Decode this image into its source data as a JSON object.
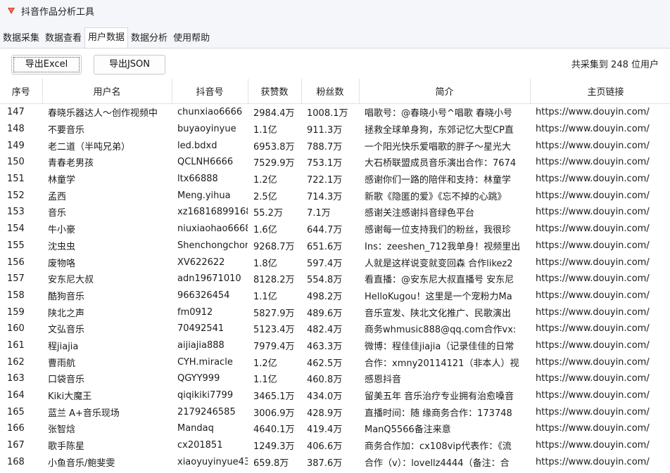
{
  "window": {
    "title": "抖音作品分析工具",
    "icon": "app-logo-icon",
    "accent_color": "#d9383a"
  },
  "tabs": [
    {
      "label": "数据采集",
      "active": false
    },
    {
      "label": "数据查看",
      "active": false
    },
    {
      "label": "用户数据",
      "active": true
    },
    {
      "label": "数据分析",
      "active": false
    },
    {
      "label": "使用帮助",
      "active": false
    }
  ],
  "toolbar": {
    "export_excel_label": "导出Excel",
    "export_json_label": "导出JSON",
    "count_text": "共采集到 248 位用户"
  },
  "table": {
    "headers": [
      "序号",
      "用户名",
      "抖音号",
      "获赞数",
      "粉丝数",
      "简介",
      "主页链接"
    ],
    "rows": [
      [
        "147",
        "春晓乐器达人～创作视频中",
        "chunxiao6666",
        "2984.4万",
        "1008.1万",
        "唱歌号：@春晓小号^唱歌 春晓小号",
        "https://www.douyin.com/"
      ],
      [
        "148",
        "不要音乐",
        "buyaoyinyue",
        "1.1亿",
        "911.3万",
        "拯救全球单身狗，东郊记忆大型CP直",
        "https://www.douyin.com/"
      ],
      [
        "149",
        "老二道（半吨兄弟）",
        "led.bdxd",
        "6953.8万",
        "788.7万",
        "一个阳光快乐爱唱歌的胖子～星光大",
        "https://www.douyin.com/"
      ],
      [
        "150",
        "青春老男孩",
        "QCLNH6666",
        "7529.9万",
        "753.1万",
        "大石桥联盟成员音乐演出合作：7674",
        "https://www.douyin.com/"
      ],
      [
        "151",
        "林童学",
        "ltx66888",
        "1.2亿",
        "722.1万",
        "感谢你们一路的陪伴和支持：林童学",
        "https://www.douyin.com/"
      ],
      [
        "152",
        "孟西",
        "Meng.yihua",
        "2.5亿",
        "714.3万",
        "新歌《隐匿的爱》《忘不掉的心跳》",
        "https://www.douyin.com/"
      ],
      [
        "153",
        "音乐",
        "xz16816899168",
        "55.2万",
        "7.1万",
        "感谢关注感谢抖音绿色平台",
        "https://www.douyin.com/"
      ],
      [
        "154",
        "牛小豪",
        "niuxiaohao6668",
        "1.6亿",
        "644.7万",
        "感谢每一位支持我们的粉丝，我很珍",
        "https://www.douyin.com/"
      ],
      [
        "155",
        "沈虫虫",
        "Shenchongchon",
        "9268.7万",
        "651.6万",
        "Ins：zeeshen_712我单身！视频里出",
        "https://www.douyin.com/"
      ],
      [
        "156",
        "废物咯",
        "XV622622",
        "1.8亿",
        "597.4万",
        "人就是这样说变就变回森 合作likez2",
        "https://www.douyin.com/"
      ],
      [
        "157",
        "安东尼大叔",
        "adn19671010",
        "8128.2万",
        "554.8万",
        "看直播：@安东尼大叔直播号 安东尼",
        "https://www.douyin.com/"
      ],
      [
        "158",
        "酷狗音乐",
        "966326454",
        "1.1亿",
        "498.2万",
        "HelloKugou！这里是一个宠粉力Ma",
        "https://www.douyin.com/"
      ],
      [
        "159",
        "陕北之声",
        "fm0912",
        "5827.9万",
        "489.6万",
        "音乐宣发、陕北文化推广、民歌演出",
        "https://www.douyin.com/"
      ],
      [
        "160",
        "文弘音乐",
        "70492541",
        "5123.4万",
        "482.4万",
        "商务whmusic888@qq.com合作vx:",
        "https://www.douyin.com/"
      ],
      [
        "161",
        "程jiajia",
        "aijiajia888",
        "7979.4万",
        "463.3万",
        "微博：程佳佳jiajia（记录佳佳的日常",
        "https://www.douyin.com/"
      ],
      [
        "162",
        "曹雨航",
        "CYH.miracle",
        "1.2亿",
        "462.5万",
        "合作：xmny20114121（非本人）视",
        "https://www.douyin.com/"
      ],
      [
        "163",
        "口袋音乐",
        "QGYY999",
        "1.1亿",
        "460.8万",
        "感恩抖音",
        "https://www.douyin.com/"
      ],
      [
        "164",
        "Kiki大魔王",
        "qiqikiki7799",
        "3465.1万",
        "434.0万",
        "留美五年 音乐治疗专业拥有治愈嗓音",
        "https://www.douyin.com/"
      ],
      [
        "165",
        "蓝兰 A+音乐现场",
        "2179246585",
        "3006.9万",
        "428.9万",
        "直播时间：随 缘商务合作：173748",
        "https://www.douyin.com/"
      ],
      [
        "166",
        "张智焓",
        "Mandaq",
        "4640.1万",
        "419.4万",
        "ManQ5566备注来意",
        "https://www.douyin.com/"
      ],
      [
        "167",
        "歌手陈星",
        "cx201851",
        "1249.3万",
        "406.6万",
        "商务合作加：cx108vip代表作：《流",
        "https://www.douyin.com/"
      ],
      [
        "168",
        "小鱼音乐/鲍斐雯",
        "xiaoyuyinyue43",
        "659.8万",
        "387.6万",
        "合作（v）：lovellz4444（备注：合",
        "https://www.douyin.com/"
      ]
    ]
  }
}
